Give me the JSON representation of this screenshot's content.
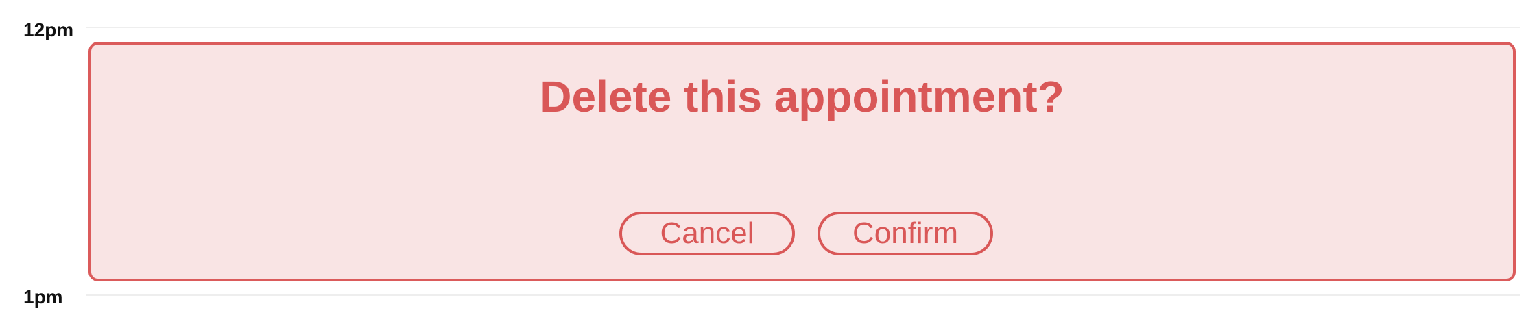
{
  "calendar": {
    "time_labels": {
      "start": "12pm",
      "end": "1pm"
    }
  },
  "dialog": {
    "title": "Delete this appointment?",
    "cancel_label": "Cancel",
    "confirm_label": "Confirm"
  },
  "colors": {
    "accent": "#d95757",
    "card_background": "#f9e4e4",
    "time_label": "#111111",
    "hour_line": "#eeeeee"
  }
}
